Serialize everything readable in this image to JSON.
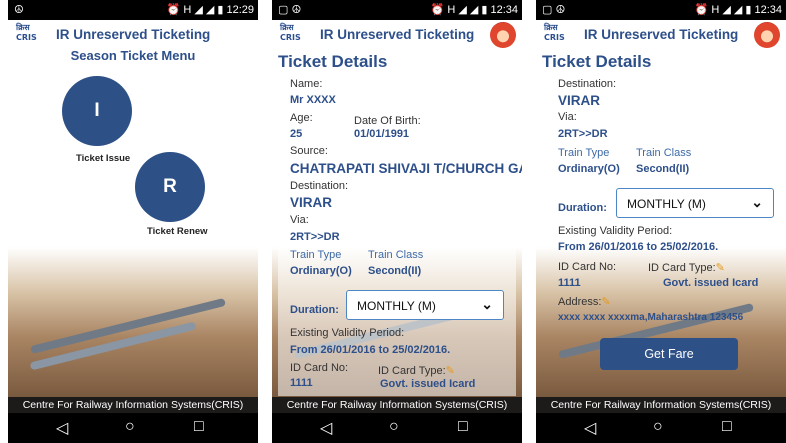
{
  "common": {
    "logo_text": "क्रिस CRIS",
    "app_title": "IR Unreserved Ticketing",
    "footer": "Centre For Railway Information Systems(CRIS)",
    "nav_back": "◁",
    "nav_home": "○",
    "nav_recent": "□"
  },
  "screen1": {
    "status_left": "☮",
    "status_right": "⏰ H ◢ ◢ ▮ 12:29",
    "subtitle": "Season Ticket Menu",
    "issue_letter": "I",
    "issue_label": "Ticket Issue",
    "renew_letter": "R",
    "renew_label": "Ticket Renew"
  },
  "screen2": {
    "status_left": "▢ ☮",
    "status_right": "⏰ H ◢ ◢ ▮ 12:34",
    "title": "Ticket Details",
    "name_label": "Name:",
    "name_value": "Mr XXXX",
    "age_label": "Age:",
    "age_value": "25",
    "dob_label": "Date Of Birth:",
    "dob_value": "01/01/1991",
    "source_label": "Source:",
    "source_value": "CHATRAPATI SHIVAJI T/CHURCH GATE",
    "dest_label": "Destination:",
    "dest_value": "VIRAR",
    "via_label": "Via:",
    "via_value": "2RT>>DR",
    "train_type_label": "Train Type",
    "train_type_value": "Ordinary(O)",
    "train_class_label": "Train Class",
    "train_class_value": "Second(II)",
    "duration_label": "Duration:",
    "duration_value": "MONTHLY (M)",
    "validity_label": "Existing Validity Period:",
    "validity_value": "From 26/01/2016 to 25/02/2016.",
    "idcard_label": "ID Card No:",
    "idcard_value": "1111",
    "idtype_label": "ID Card Type:",
    "idtype_value": "Govt. issued Icard"
  },
  "screen3": {
    "status_left": "▢ ☮",
    "status_right": "⏰ H ◢ ◢ ▮ 12:34",
    "title": "Ticket Details",
    "dest_label": "Destination:",
    "dest_value": "VIRAR",
    "via_label": "Via:",
    "via_value": "2RT>>DR",
    "train_type_label": "Train Type",
    "train_type_value": "Ordinary(O)",
    "train_class_label": "Train Class",
    "train_class_value": "Second(II)",
    "duration_label": "Duration:",
    "duration_value": "MONTHLY (M)",
    "validity_label": "Existing Validity Period:",
    "validity_value": "From 26/01/2016 to 25/02/2016.",
    "idcard_label": "ID Card No:",
    "idcard_value": "1111",
    "idtype_label": "ID Card Type:",
    "idtype_value": "Govt. issued Icard",
    "address_label": "Address:",
    "address_value": "xxxx xxxx xxxxma,Maharashtra 123456",
    "fare_button": "Get Fare"
  },
  "colors": {
    "primary": "#2d5086",
    "title_blue": "#2d4f8a",
    "dropdown_border": "#4d86c4",
    "edit_pencil": "#e39a1d"
  },
  "icons": {
    "pencil": "✎",
    "chevron": "⌄"
  }
}
